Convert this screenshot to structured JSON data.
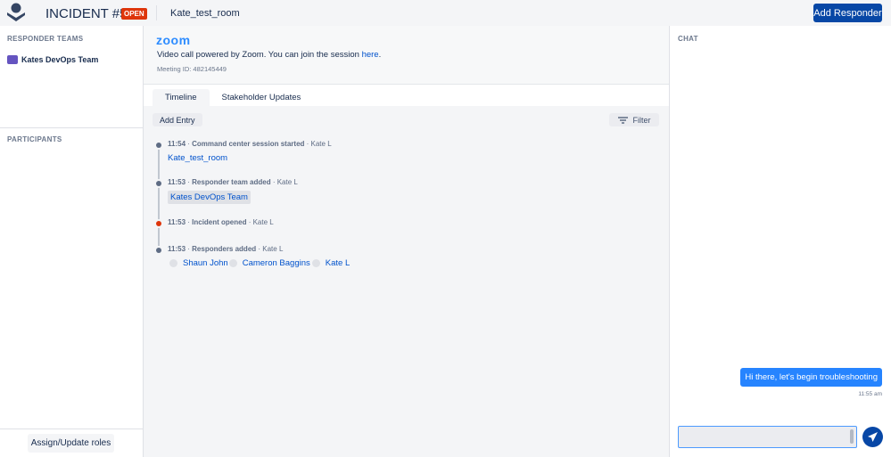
{
  "header": {
    "title": "INCIDENT #56",
    "status": "OPEN",
    "room": "Kate_test_room",
    "add_responder": "Add Responder"
  },
  "sidebar": {
    "responder_teams_label": "RESPONDER TEAMS",
    "teams": [
      "Kates DevOps Team"
    ],
    "participants_label": "PARTICIPANTS",
    "assign_button": "Assign/Update roles"
  },
  "zoom": {
    "logo": "zoom",
    "text": "Video call powered by Zoom. You can join the session ",
    "link": "here",
    "period": ".",
    "meeting_id": "Meeting ID: 482145449"
  },
  "tabs": [
    "Timeline",
    "Stakeholder Updates"
  ],
  "toolbar": {
    "add_entry": "Add Entry",
    "filter": "Filter"
  },
  "timeline": [
    {
      "time": "11:54",
      "event": "Command center session started",
      "author": "Kate L",
      "detail": "Kate_test_room"
    },
    {
      "time": "11:53",
      "event": "Responder team added",
      "author": "Kate L",
      "detail": "Kates DevOps Team"
    },
    {
      "time": "11:53",
      "event": "Incident opened",
      "author": "Kate L"
    },
    {
      "time": "11:53",
      "event": "Responders added",
      "author": "Kate L",
      "responders": [
        "Shaun John",
        "Cameron Baggins",
        "Kate L"
      ]
    }
  ],
  "chat": {
    "label": "CHAT",
    "messages": [
      {
        "text": "Hi there, let's begin troubleshooting",
        "time": "11:55 am"
      }
    ],
    "input_value": ""
  },
  "colors": {
    "accent": "#0747a6",
    "open_badge": "#de350b",
    "bubble": "#2684ff",
    "team": "#6554c0"
  }
}
